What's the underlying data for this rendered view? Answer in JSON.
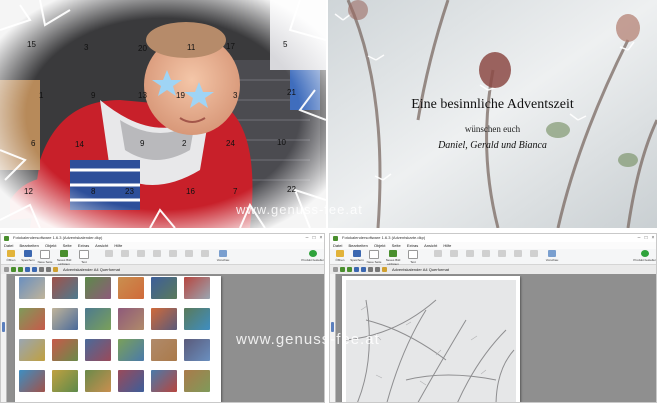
{
  "calendar_photo": {
    "day_numbers": [
      "15",
      "3",
      "20",
      "11",
      "17",
      "5",
      "21",
      "1",
      "9",
      "13",
      "19",
      "3",
      "6",
      "14",
      "9",
      "2",
      "24",
      "10",
      "12",
      "8",
      "23",
      "16",
      "7",
      "22"
    ],
    "star_left": "★",
    "star_right": "★"
  },
  "greeting_card": {
    "title": "Eine besinnliche Adventszeit",
    "subtitle": "wünschen euch",
    "names": "Daniel, Gerald und Bianca"
  },
  "watermarks": [
    "www.genuss-fee.at",
    "www.genuss-fee.at"
  ],
  "app_left": {
    "window_title": "Fotokalendersoftware 1.6.3 (Adventskalender.dkp)",
    "menu": [
      "Datei",
      "Bearbeiten",
      "Objekt",
      "Seite",
      "Extras",
      "Ansicht",
      "Hilfe"
    ],
    "ribbon_buttons": [
      "Öffnen",
      "Speichern",
      "Neue Seite",
      "Neues Bild einfügen",
      "Text einfügen",
      "",
      "",
      "",
      "",
      "",
      "",
      "",
      "Vorschau"
    ],
    "order_button": "Produkt bestellen",
    "doc_tab": "Adventskalender A4 Querformat"
  },
  "app_right": {
    "window_title": "Fotokalendersoftware 1.6.3 (Adventskarte.dkp)",
    "menu": [
      "Datei",
      "Bearbeiten",
      "Objekt",
      "Seite",
      "Extras",
      "Ansicht",
      "Hilfe"
    ],
    "ribbon_buttons": [
      "Öffnen",
      "Speichern",
      "Neue Seite",
      "Neues Bild einfügen",
      "Text einfügen",
      "",
      "",
      "",
      "",
      "",
      "",
      "",
      "Vorschau"
    ],
    "order_button": "Produkt bestellen",
    "doc_tab": "Adventskalender A4 Querformat"
  },
  "colors": {
    "ribbon_green": "#4a8f2e",
    "workspace_gray": "#8f8f8f",
    "sweater_red": "#c8202a"
  }
}
